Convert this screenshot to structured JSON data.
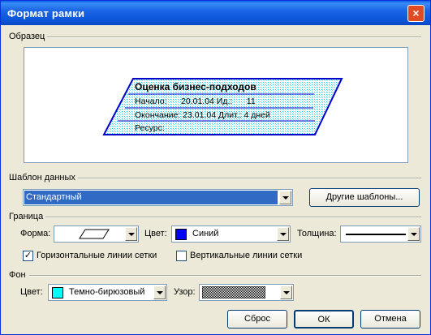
{
  "window": {
    "title": "Формат рамки",
    "close_label": "×"
  },
  "sample": {
    "section_label": "Образец",
    "box_title": "Оценка бизнес-подходов",
    "row1": "Начало:      20.01.04 Ид.:      11",
    "row2": "Окончание: 23.01.04 Длит.: 4 дней",
    "row3": "Ресурс:"
  },
  "template": {
    "section_label": "Шаблон данных",
    "selected": "Стандартный",
    "other_button": "Другие шаблоны..."
  },
  "border": {
    "section_label": "Граница",
    "shape_label": "Форма:",
    "color_label": "Цвет:",
    "color_value": "Синий",
    "color_hex": "#0000ff",
    "thickness_label": "Толщина:",
    "horizontal_gridlines": {
      "label": "Горизонтальные линии сетки",
      "checked": true
    },
    "vertical_gridlines": {
      "label": "Вертикальные линии сетки",
      "checked": false
    }
  },
  "background": {
    "section_label": "Фон",
    "color_label": "Цвет:",
    "color_value": "Темно-бирюзовый",
    "color_hex": "#00ffff",
    "pattern_label": "Узор:"
  },
  "buttons": {
    "reset": "Сброс",
    "ok": "ОК",
    "cancel": "Отмена"
  }
}
